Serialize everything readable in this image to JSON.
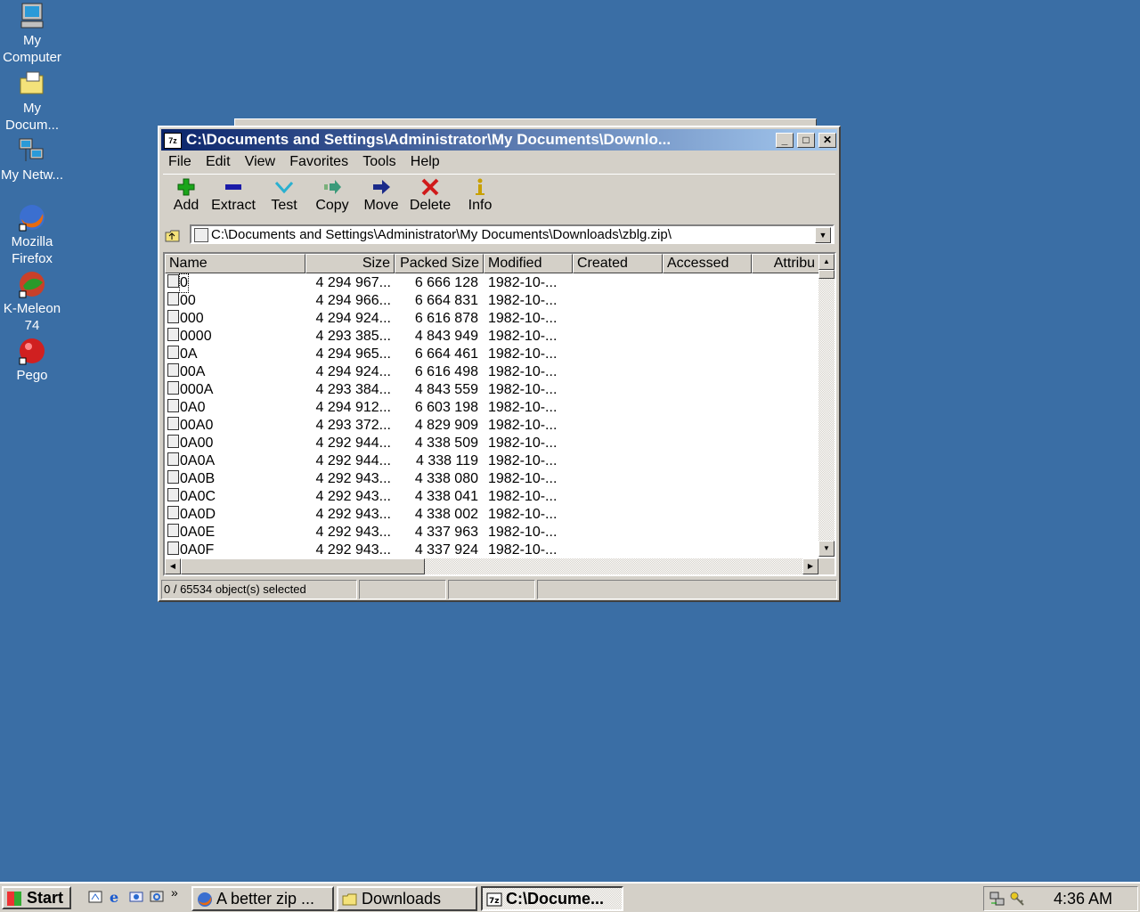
{
  "desktop": {
    "icons": [
      {
        "label": "My Computer"
      },
      {
        "label": "My Docum..."
      },
      {
        "label": "My Netw..."
      },
      {
        "label": "Mozilla Firefox"
      },
      {
        "label": "K-Meleon 74"
      },
      {
        "label": "Pego"
      }
    ]
  },
  "window": {
    "app_icon": "7z",
    "title": "C:\\Documents and Settings\\Administrator\\My Documents\\Downlo...",
    "menu": [
      "File",
      "Edit",
      "View",
      "Favorites",
      "Tools",
      "Help"
    ],
    "toolbar": [
      {
        "label": "Add",
        "icon": "plus-icon",
        "color": "#1aa51a"
      },
      {
        "label": "Extract",
        "icon": "minus-icon",
        "color": "#1a1aa8"
      },
      {
        "label": "Test",
        "icon": "check-icon",
        "color": "#2ab0d0"
      },
      {
        "label": "Copy",
        "icon": "copy-arrow-icon",
        "color": "#3a9a7a"
      },
      {
        "label": "Move",
        "icon": "move-arrow-icon",
        "color": "#1a2a8a"
      },
      {
        "label": "Delete",
        "icon": "x-icon",
        "color": "#d01a1a"
      },
      {
        "label": "Info",
        "icon": "info-icon",
        "color": "#c8a000"
      }
    ],
    "address": "C:\\Documents and Settings\\Administrator\\My Documents\\Downloads\\zblg.zip\\",
    "columns": [
      "Name",
      "Size",
      "Packed Size",
      "Modified",
      "Created",
      "Accessed",
      "Attribu"
    ],
    "rows": [
      {
        "name": "0",
        "size": "4 294 967...",
        "packed": "6 666 128",
        "modified": "1982-10-..."
      },
      {
        "name": "00",
        "size": "4 294 966...",
        "packed": "6 664 831",
        "modified": "1982-10-..."
      },
      {
        "name": "000",
        "size": "4 294 924...",
        "packed": "6 616 878",
        "modified": "1982-10-..."
      },
      {
        "name": "0000",
        "size": "4 293 385...",
        "packed": "4 843 949",
        "modified": "1982-10-..."
      },
      {
        "name": "0A",
        "size": "4 294 965...",
        "packed": "6 664 461",
        "modified": "1982-10-..."
      },
      {
        "name": "00A",
        "size": "4 294 924...",
        "packed": "6 616 498",
        "modified": "1982-10-..."
      },
      {
        "name": "000A",
        "size": "4 293 384...",
        "packed": "4 843 559",
        "modified": "1982-10-..."
      },
      {
        "name": "0A0",
        "size": "4 294 912...",
        "packed": "6 603 198",
        "modified": "1982-10-..."
      },
      {
        "name": "00A0",
        "size": "4 293 372...",
        "packed": "4 829 909",
        "modified": "1982-10-..."
      },
      {
        "name": "0A00",
        "size": "4 292 944...",
        "packed": "4 338 509",
        "modified": "1982-10-..."
      },
      {
        "name": "0A0A",
        "size": "4 292 944...",
        "packed": "4 338 119",
        "modified": "1982-10-..."
      },
      {
        "name": "0A0B",
        "size": "4 292 943...",
        "packed": "4 338 080",
        "modified": "1982-10-..."
      },
      {
        "name": "0A0C",
        "size": "4 292 943...",
        "packed": "4 338 041",
        "modified": "1982-10-..."
      },
      {
        "name": "0A0D",
        "size": "4 292 943...",
        "packed": "4 338 002",
        "modified": "1982-10-..."
      },
      {
        "name": "0A0E",
        "size": "4 292 943...",
        "packed": "4 337 963",
        "modified": "1982-10-..."
      },
      {
        "name": "0A0F",
        "size": "4 292 943...",
        "packed": "4 337 924",
        "modified": "1982-10-..."
      }
    ],
    "status": "0 / 65534 object(s) selected"
  },
  "taskbar": {
    "start": "Start",
    "tasks": [
      {
        "label": "A better zip ..."
      },
      {
        "label": "Downloads"
      },
      {
        "label": "C:\\Docume..."
      }
    ],
    "clock": "4:36 AM",
    "chevron": "»"
  },
  "colors": {
    "desktop": "#3a6ea5",
    "title_active": "#0a246a",
    "face": "#d4d0c8"
  }
}
